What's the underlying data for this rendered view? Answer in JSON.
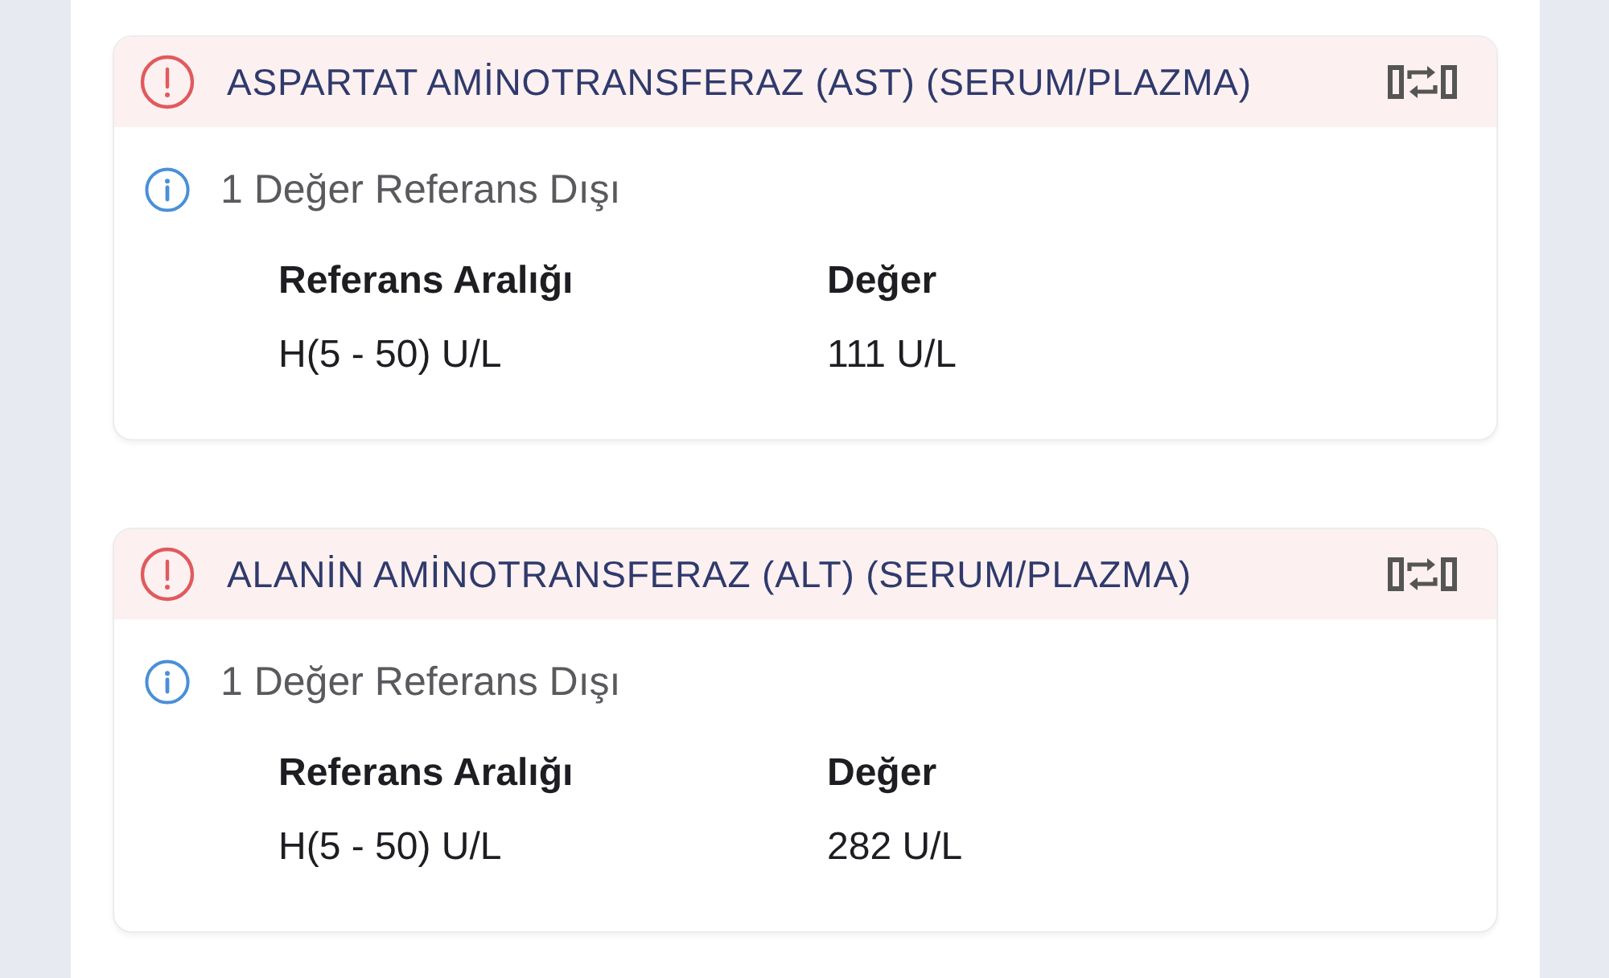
{
  "results": [
    {
      "title": "ASPARTAT AMİNOTRANSFERAZ (AST) (SERUM/PLAZMA)",
      "alert": true,
      "notice": "1 Değer Referans Dışı",
      "columns": [
        {
          "label": "Referans Aralığı",
          "value": "H(5 - 50) U/L"
        },
        {
          "label": "Değer",
          "value": "111 U/L"
        }
      ]
    },
    {
      "title": "ALANİN AMİNOTRANSFERAZ (ALT) (SERUM/PLAZMA)",
      "alert": true,
      "notice": "1 Değer Referans Dışı",
      "columns": [
        {
          "label": "Referans Aralığı",
          "value": "H(5 - 50) U/L"
        },
        {
          "label": "Değer",
          "value": "282 U/L"
        }
      ]
    }
  ]
}
